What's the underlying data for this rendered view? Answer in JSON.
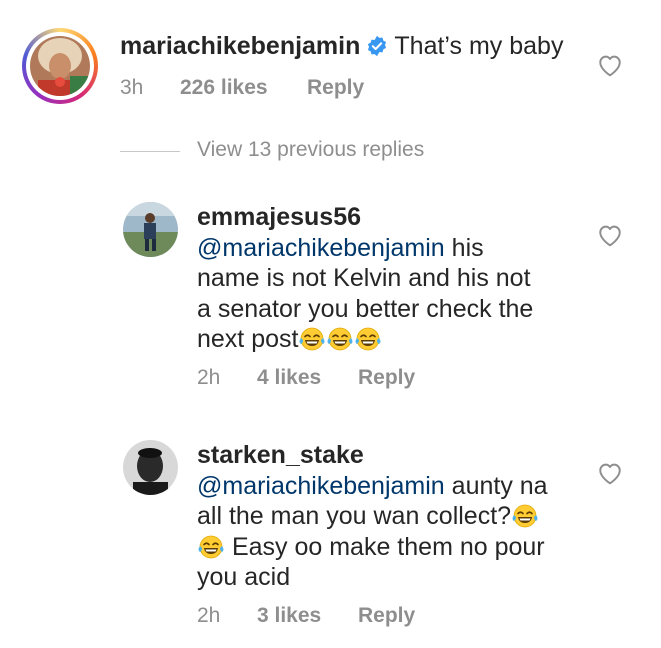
{
  "main_comment": {
    "username": "mariachikebenjamin",
    "verified": true,
    "text": "That’s my baby",
    "time": "3h",
    "likes": "226 likes",
    "reply": "Reply"
  },
  "view_replies": {
    "label": "View 13 previous replies"
  },
  "replies": [
    {
      "username": "emmajesus56",
      "mention": "@mariachikebenjamin",
      "text_line1": "his",
      "text_line2": "name is not Kelvin and his not",
      "text_line3": "a senator you better check the",
      "text_line4": "next post",
      "emojis": [
        "face-with-tears-of-joy",
        "face-with-tears-of-joy",
        "face-with-tears-of-joy"
      ],
      "time": "2h",
      "likes": "4 likes",
      "reply": "Reply"
    },
    {
      "username": "starken_stake",
      "mention": "@mariachikebenjamin",
      "text_line1": "aunty na",
      "text_line2": "all the man you wan collect?",
      "text_line3": "Easy oo make them no pour",
      "text_line4": "you acid",
      "emojis": [
        "face-with-tears-of-joy",
        "face-with-tears-of-joy"
      ],
      "time": "2h",
      "likes": "3 likes",
      "reply": "Reply"
    }
  ],
  "icons": {
    "like": "heart-outline-icon",
    "verified": "verified-badge-icon",
    "emoji": "face-with-tears-of-joy"
  },
  "colors": {
    "text": "#262626",
    "meta": "#8e8e8e",
    "mention": "#00376b",
    "verified": "#3897f0"
  }
}
